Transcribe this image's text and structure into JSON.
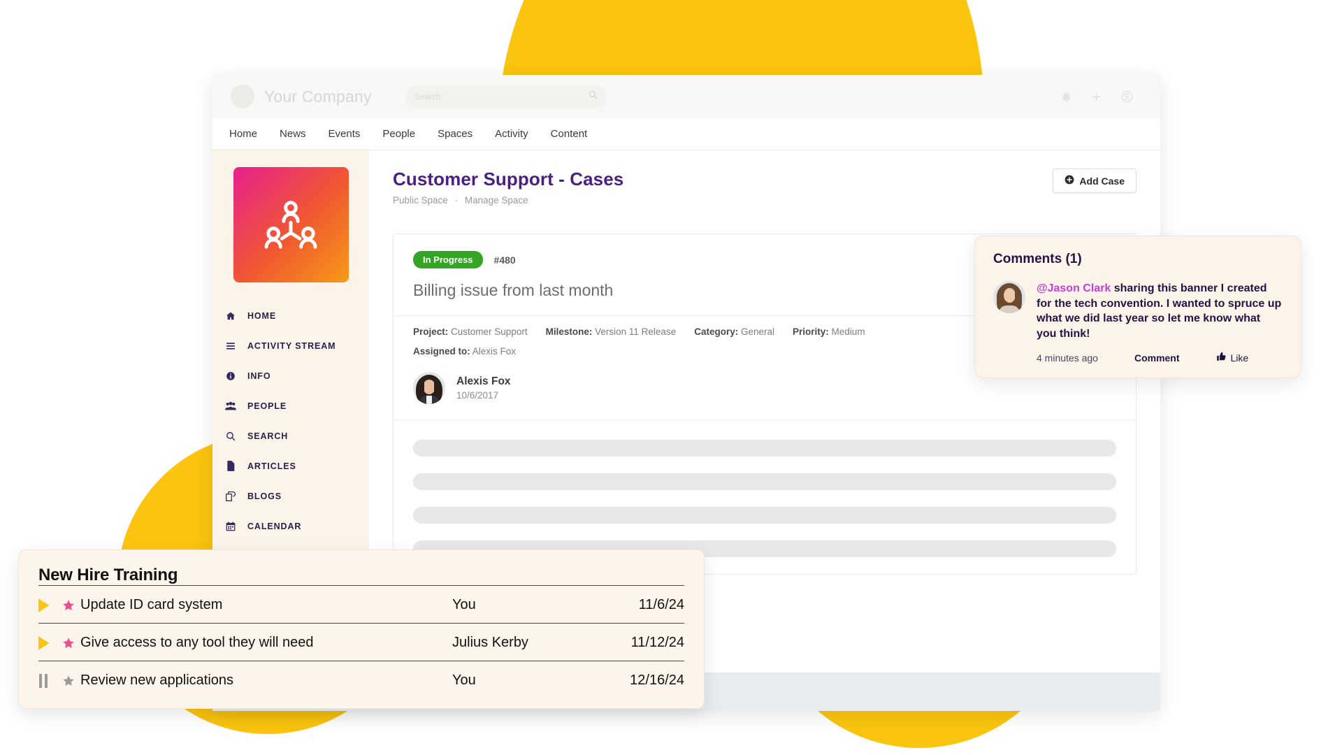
{
  "colors": {
    "accent_yellow": "#FBC40E",
    "brand_purple": "#4B1E82",
    "status_green": "#34A524",
    "mention_pink": "#C03FD6",
    "star_pink": "#ED4C8A",
    "card_cream": "#FDF4E9"
  },
  "appbar": {
    "brand_name": "Your Company",
    "search_placeholder": "Search",
    "search_value": "",
    "icons": [
      "bell-icon",
      "plus-icon",
      "account-circle-icon"
    ]
  },
  "nav": {
    "items": [
      {
        "label": "Home"
      },
      {
        "label": "News"
      },
      {
        "label": "Events"
      },
      {
        "label": "People"
      },
      {
        "label": "Spaces"
      },
      {
        "label": "Activity"
      },
      {
        "label": "Content"
      }
    ]
  },
  "sidebar": {
    "space_icon": "people-network-icon",
    "items": [
      {
        "label": "HOME",
        "icon": "home-icon"
      },
      {
        "label": "ACTIVITY STREAM",
        "icon": "list-icon"
      },
      {
        "label": "INFO",
        "icon": "info-circle-icon"
      },
      {
        "label": "PEOPLE",
        "icon": "people-group-icon"
      },
      {
        "label": "SEARCH",
        "icon": "search-icon"
      },
      {
        "label": "ARTICLES",
        "icon": "document-icon"
      },
      {
        "label": "BLOGS",
        "icon": "blogs-icon"
      },
      {
        "label": "CALENDAR",
        "icon": "calendar-icon"
      }
    ]
  },
  "space": {
    "title": "Customer Support - Cases",
    "visibility": "Public Space",
    "separator": "·",
    "manage_link": "Manage Space",
    "add_button": "Add Case",
    "add_button_icon": "plus-circle-icon"
  },
  "case": {
    "status": "In Progress",
    "number": "#480",
    "title": "Billing issue from last month",
    "meta": [
      {
        "label": "Project:",
        "value": "Customer Support"
      },
      {
        "label": "Milestone:",
        "value": "Version 11 Release"
      },
      {
        "label": "Category:",
        "value": "General"
      },
      {
        "label": "Priority:",
        "value": "Medium"
      }
    ],
    "assigned_label": "Assigned to:",
    "assigned_value": "Alexis Fox",
    "author_name": "Alexis Fox",
    "author_date": "10/6/2017",
    "body_placeholder_bars": 4
  },
  "comments": {
    "title": "Comments (1)",
    "items": [
      {
        "mention": "@Jason Clark",
        "text": " sharing this banner I created for the tech convention. I wanted to spruce up what we did last year so let me know what you think!",
        "time": "4 minutes ago",
        "reply_label": "Comment",
        "like_label": "Like",
        "like_icon": "thumbs-up-icon"
      }
    ]
  },
  "tasks": {
    "title": "New Hire Training",
    "rows": [
      {
        "status_icon": "play-icon",
        "starred": true,
        "label": "Update ID card system",
        "owner": "You",
        "date": "11/6/24"
      },
      {
        "status_icon": "play-icon",
        "starred": true,
        "label": "Give access to any tool they will need",
        "owner": "Julius Kerby",
        "date": "11/12/24"
      },
      {
        "status_icon": "pause-icon",
        "starred": false,
        "label": "Review new applications",
        "owner": "You",
        "date": "12/16/24"
      }
    ]
  }
}
